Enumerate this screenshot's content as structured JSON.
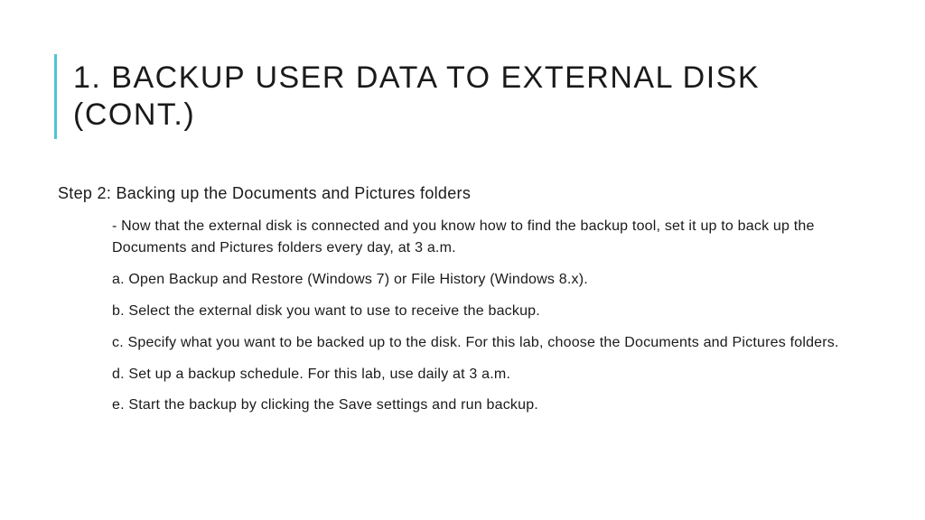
{
  "title": "1. BACKUP USER DATA TO EXTERNAL DISK (CONT.)",
  "step_heading": "Step 2: Backing up the Documents and Pictures folders",
  "items": {
    "intro": "- Now that the external disk is connected and you know how to find the backup tool, set it up to back up the Documents and Pictures folders every day, at 3 a.m.",
    "a": "a. Open Backup and Restore (Windows 7) or File History (Windows 8.x).",
    "b": "b. Select the external disk you want to use to receive the backup.",
    "c": "c. Specify what you want to be backed up to the disk. For this lab, choose the Documents and Pictures folders.",
    "d": "d. Set up a backup schedule. For this lab, use daily at 3 a.m.",
    "e": "e. Start the backup by clicking the Save settings and run backup."
  }
}
